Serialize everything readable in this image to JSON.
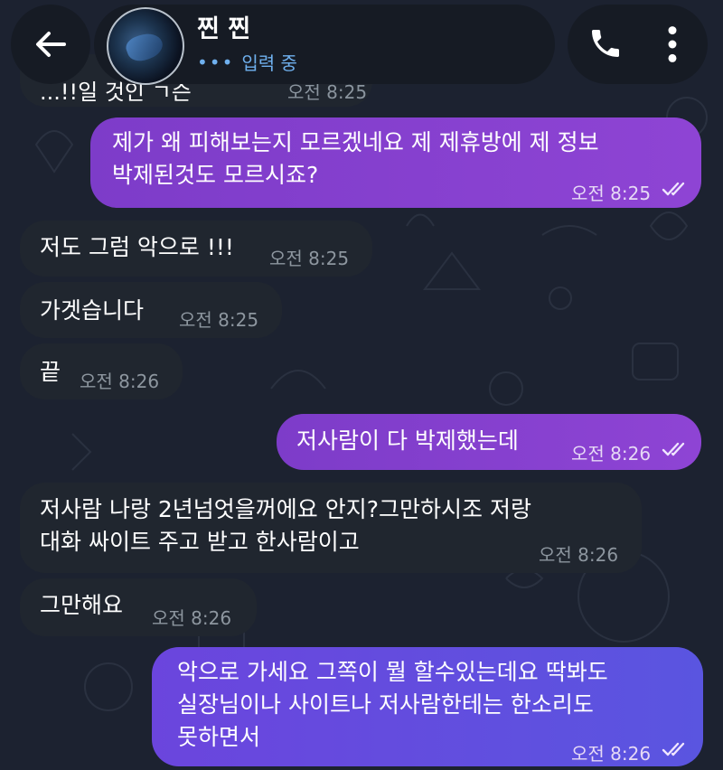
{
  "header": {
    "back_icon": "arrow-left-icon",
    "name": "찐 찐",
    "status_dots": "•••",
    "status": "입력 중",
    "call_icon": "phone-icon",
    "menu_icon": "more-vertical-icon"
  },
  "partial_message": {
    "text": "...!!일 것인 ㄱ슨",
    "time": "오전 8:25"
  },
  "messages": [
    {
      "direction": "out",
      "text": "제가 왜 피해보는지 모르겠네요 제 제휴방에 제 정보\n박제된것도 모르시죠?",
      "time": "오전 8:25",
      "read": true
    },
    {
      "direction": "in",
      "text": "저도 그럼 악으로 !!!",
      "time": "오전 8:25"
    },
    {
      "direction": "in",
      "text": "가겟습니다",
      "time": "오전 8:25"
    },
    {
      "direction": "in",
      "text": "끝",
      "time": "오전 8:26"
    },
    {
      "direction": "out",
      "text": "저사람이 다 박제했는데",
      "time": "오전 8:26",
      "read": true
    },
    {
      "direction": "in",
      "text": "저사람 나랑 2년넘엇을꺼에요 안지?그만하시조 저랑\n대화 싸이트 주고 받고 한사람이고",
      "time": "오전 8:26"
    },
    {
      "direction": "in",
      "text": "그만해요",
      "time": "오전 8:26"
    },
    {
      "direction": "out",
      "text": "악으로 가세요 그쪽이 뭘 할수있는데요 딱봐도\n실장님이나 사이트나 저사람한테는 한소리도\n못하면서",
      "time": "오전 8:26",
      "read": true
    }
  ],
  "colors": {
    "background": "#1c2230",
    "incoming_bubble": "#20262f",
    "outgoing_bubble": "#8e44d4",
    "outgoing_bubble_last": "#5a55e0",
    "typing": "#6fb0ee"
  }
}
